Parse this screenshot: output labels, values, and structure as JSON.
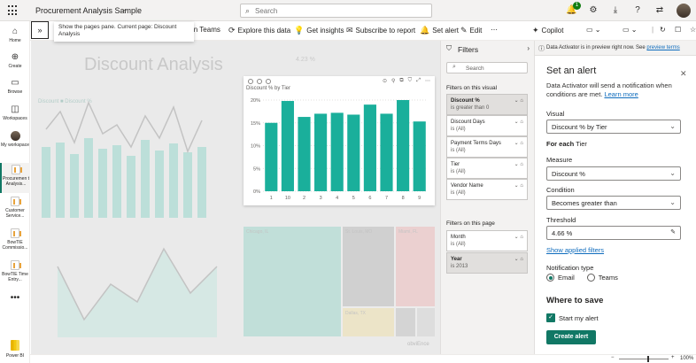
{
  "app": {
    "title": "Procurement Analysis Sample",
    "search_placeholder": "Search",
    "notification_count": "1"
  },
  "rail": [
    {
      "label": "Home",
      "icon": "home-icon"
    },
    {
      "label": "Create",
      "icon": "plus-icon"
    },
    {
      "label": "Browse",
      "icon": "folder-icon"
    },
    {
      "label": "Workspaces",
      "icon": "workspaces-icon"
    },
    {
      "label": "My workspace",
      "icon": "person-icon"
    },
    {
      "label": "Procuremen t Analysis...",
      "icon": "report-icon"
    },
    {
      "label": "Customer Service...",
      "icon": "report-icon"
    },
    {
      "label": "BowTIE Commissio...",
      "icon": "report-icon"
    },
    {
      "label": "BowTIE Time Entry...",
      "icon": "report-icon"
    },
    {
      "label": "Power BI",
      "icon": "powerbi-logo"
    }
  ],
  "toolbar": {
    "teams": "in Teams",
    "explore": "Explore this data",
    "insights": "Get insights",
    "subscribe": "Subscribe to report",
    "set_alert": "Set alert",
    "edit": "Edit",
    "copilot": "Copilot"
  },
  "tooltip": "Show the pages pane. Current page: Discount Analysis",
  "canvas": {
    "title": "Discount Analysis",
    "kpi": "4.23 %",
    "legend": "Discount  ■ Discount %",
    "treemap": [
      "Chicago, IL",
      "St. Louis, MO",
      "Miami, FL",
      "Dallas, TX"
    ],
    "watermark": "obviEnce"
  },
  "chart_data": {
    "type": "bar",
    "title": "Discount % by Tier",
    "categories": [
      "1",
      "10",
      "2",
      "3",
      "4",
      "5",
      "6",
      "7",
      "8",
      "9"
    ],
    "values": [
      15.0,
      19.8,
      16.3,
      17.0,
      17.2,
      16.8,
      19.0,
      17.0,
      20.0,
      15.3
    ],
    "ylim": [
      0,
      20
    ],
    "yticks": [
      "0%",
      "5%",
      "10%",
      "15%",
      "20%"
    ],
    "color": "#1aaf9b"
  },
  "filters": {
    "title": "Filters",
    "search_placeholder": "Search",
    "section_visual": "Filters on this visual",
    "section_page": "Filters on this page",
    "visual": [
      {
        "name": "Discount %",
        "value": "is greater than 0",
        "highlighted": true
      },
      {
        "name": "Discount Days",
        "value": "is (All)"
      },
      {
        "name": "Payment Terms Days",
        "value": "is (All)"
      },
      {
        "name": "Tier",
        "value": "is (All)"
      },
      {
        "name": "Vendor Name",
        "value": "is (All)"
      }
    ],
    "page": [
      {
        "name": "Month",
        "value": "is (All)"
      },
      {
        "name": "Year",
        "value": "is 2013",
        "highlighted": true
      }
    ]
  },
  "alert": {
    "banner": "Data Activator is in preview right now. See",
    "banner_link": "preview terms",
    "title": "Set an alert",
    "description": "Data Activator will send a notification when conditions are met.",
    "learn_more": "Learn more",
    "visual_label": "Visual",
    "visual_value": "Discount % by Tier",
    "for_each_label": "For each",
    "for_each_value": "Tier",
    "measure_label": "Measure",
    "measure_value": "Discount %",
    "condition_label": "Condition",
    "condition_value": "Becomes greater than",
    "threshold_label": "Threshold",
    "threshold_value": "4.66 %",
    "show_filters": "Show applied filters",
    "notif_label": "Notification type",
    "email": "Email",
    "teams": "Teams",
    "save_title": "Where to save",
    "start_alert": "Start my alert",
    "create_button": "Create alert"
  },
  "status": {
    "zoom": "100%"
  }
}
